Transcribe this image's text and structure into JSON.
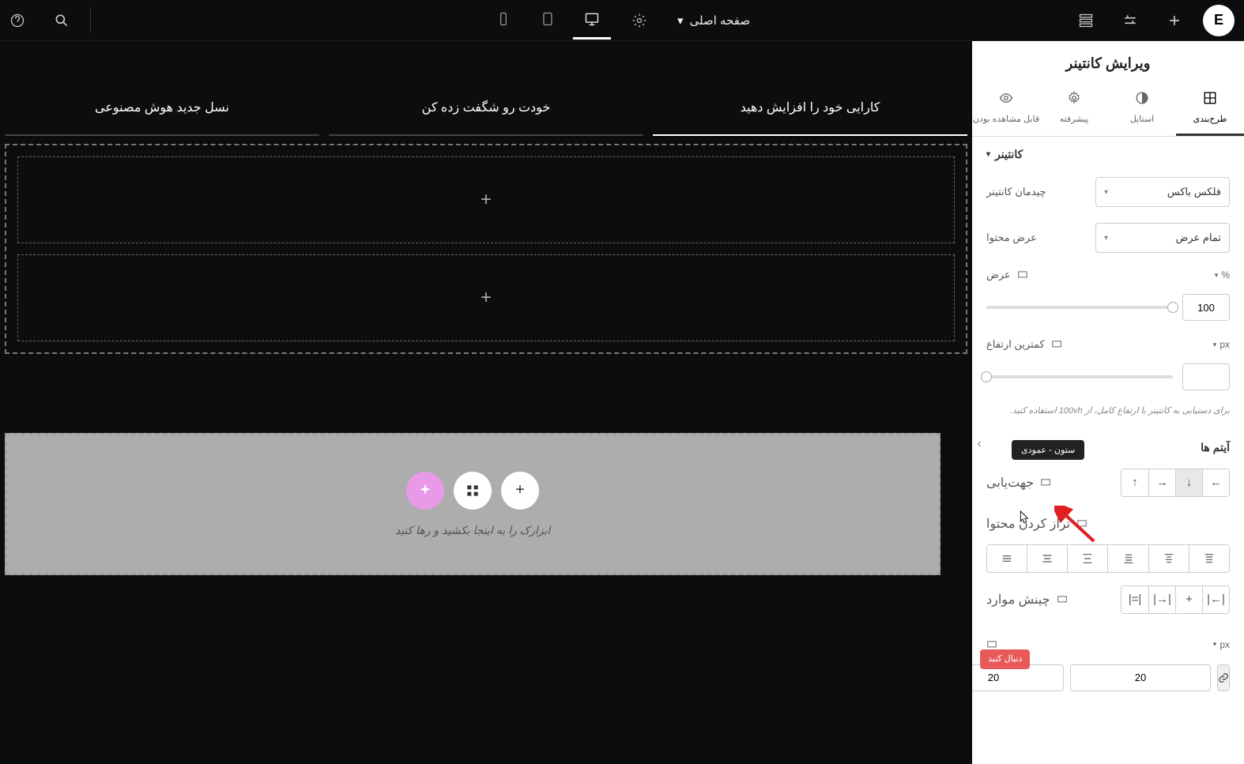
{
  "topbar": {
    "page_label": "صفحه اصلی"
  },
  "panel": {
    "title": "ویرایش کانتینر",
    "tabs": {
      "layout": "طرح‌بندی",
      "style": "استایل",
      "advanced": "پیشرفته",
      "visible": "قابل مشاهده بودن"
    },
    "section_container": "کانتینر",
    "labels": {
      "container_layout": "چیدمان کانتینر",
      "content_width": "عرض محتوا",
      "width": "عرض",
      "min_height": "کمترین ارتفاع",
      "direction": "جهت‌یابی",
      "justify": "تراز کردن محتوا",
      "align_items": "چینش موارد"
    },
    "values": {
      "container_layout": "فلکس باکس",
      "content_width": "تمام عرض",
      "width_unit": "%",
      "width_value": "100",
      "min_height_unit": "px",
      "min_height_value": "",
      "gap_unit": "px",
      "gap_value_1": "20",
      "gap_value_2": "20"
    },
    "hint": "برای دستیابی به کانتینر با ارتفاع کامل، از 100vh استفاده کنید.",
    "section_items": "آیتم ها",
    "tooltip_direction": "ستون - عمودی"
  },
  "canvas": {
    "tabs": [
      "کارایی خود را افزایش دهید",
      "خودت رو شگفت زده کن",
      "نسل جدید هوش مصنوعی"
    ],
    "drop_text": "ابزارک را به اینجا بکشید و رها کنید"
  },
  "watermark": "دنبال\nکنید"
}
